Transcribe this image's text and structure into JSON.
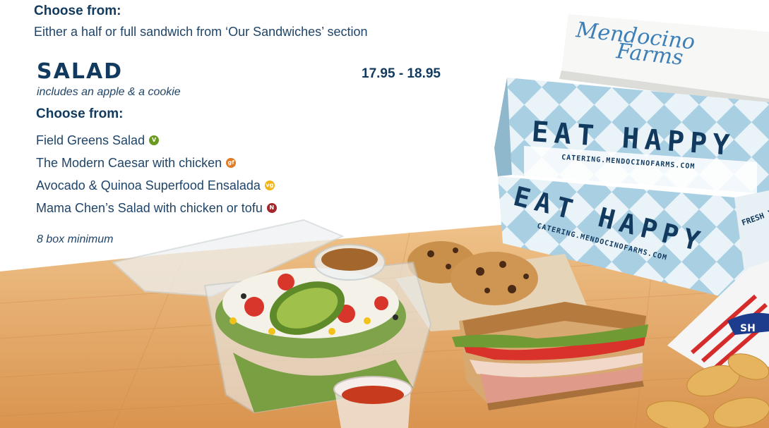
{
  "sandwich_section": {
    "choose_heading": "Choose from:",
    "description": "Either a half or full sandwich from ‘Our Sandwiches’ section"
  },
  "salad_section": {
    "title": "SALAD",
    "price": "17.95 - 18.95",
    "subtitle": "includes an apple & a cookie",
    "choose_heading": "Choose from:",
    "items": [
      {
        "label": "Field Greens Salad",
        "badge": "V",
        "badge_color": "#6a9a1f"
      },
      {
        "label": "The Modern Caesar with chicken",
        "badge": "gf",
        "badge_color": "#e07b25"
      },
      {
        "label": "Avocado & Quinoa Superfood Ensalada",
        "badge": "vg",
        "badge_color": "#f2b417"
      },
      {
        "label": "Mama Chen’s Salad with chicken or tofu",
        "badge": "N",
        "badge_color": "#a4272c"
      }
    ],
    "minimum_note": "8 box minimum"
  },
  "photo": {
    "brand_line1": "Mendocino",
    "brand_line2": "Farms",
    "box_slogan": "EAT HAPPY",
    "box_url": "CATERING.MENDOCINOFARMS.COM",
    "box_side_text": "FRESH YOU GO",
    "chip_bag_text": "SH"
  },
  "colors": {
    "heading": "#123a5e",
    "body_text": "#1f4468",
    "box_blue": "#a9cfe3",
    "counter_wood": "#e3a866"
  }
}
